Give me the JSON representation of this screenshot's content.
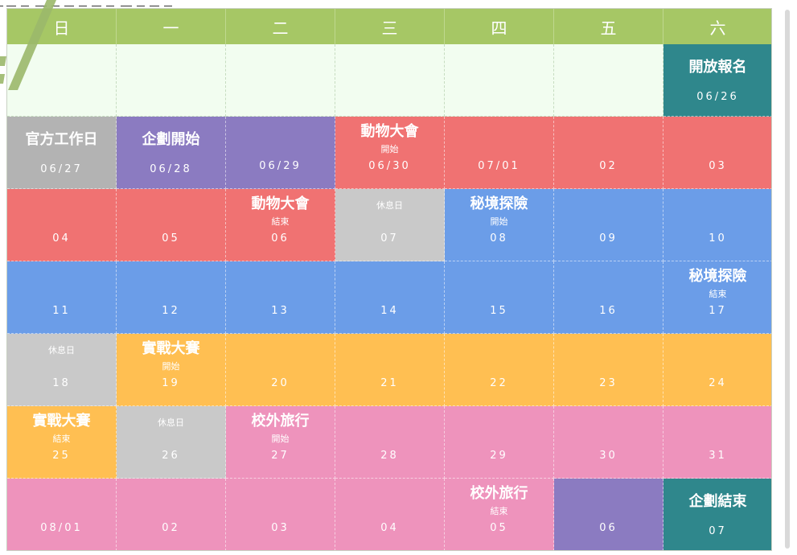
{
  "colors": {
    "header": "#a6c765",
    "empty": "#f2fdf0",
    "gray": "#c9c9c9",
    "gray_dark": "#b3b3b3",
    "purple": "#8b7bc1",
    "red": "#f07272",
    "blue": "#6b9de8",
    "orange": "#ffbf52",
    "pink": "#ee93bc",
    "teal": "#2f878c"
  },
  "calendar": {
    "weekdays": [
      "日",
      "一",
      "二",
      "三",
      "四",
      "五",
      "六"
    ],
    "weeks": [
      [
        {
          "color": "empty"
        },
        {
          "color": "empty"
        },
        {
          "color": "empty"
        },
        {
          "color": "empty"
        },
        {
          "color": "empty"
        },
        {
          "color": "empty"
        },
        {
          "color": "teal",
          "event": "開放報名",
          "date": "06/26"
        }
      ],
      [
        {
          "color": "gray_dark",
          "event": "官方工作日",
          "date": "06/27"
        },
        {
          "color": "purple",
          "event": "企劃開始",
          "date": "06/28"
        },
        {
          "color": "purple",
          "date": "06/29"
        },
        {
          "color": "red",
          "event": "動物大會",
          "sub": "開始",
          "date": "06/30"
        },
        {
          "color": "red",
          "date": "07/01"
        },
        {
          "color": "red",
          "date": "02"
        },
        {
          "color": "red",
          "date": "03"
        }
      ],
      [
        {
          "color": "red",
          "date": "04"
        },
        {
          "color": "red",
          "date": "05"
        },
        {
          "color": "red",
          "event": "動物大會",
          "sub": "結束",
          "date": "06"
        },
        {
          "color": "gray",
          "sub": "休息日",
          "date": "07"
        },
        {
          "color": "blue",
          "event": "秘境探險",
          "sub": "開始",
          "date": "08"
        },
        {
          "color": "blue",
          "date": "09"
        },
        {
          "color": "blue",
          "date": "10"
        }
      ],
      [
        {
          "color": "blue",
          "date": "11"
        },
        {
          "color": "blue",
          "date": "12"
        },
        {
          "color": "blue",
          "date": "13"
        },
        {
          "color": "blue",
          "date": "14"
        },
        {
          "color": "blue",
          "date": "15"
        },
        {
          "color": "blue",
          "date": "16"
        },
        {
          "color": "blue",
          "event": "秘境探險",
          "sub": "結束",
          "date": "17"
        }
      ],
      [
        {
          "color": "gray",
          "sub": "休息日",
          "date": "18"
        },
        {
          "color": "orange",
          "event": "實戰大賽",
          "sub": "開始",
          "date": "19"
        },
        {
          "color": "orange",
          "date": "20"
        },
        {
          "color": "orange",
          "date": "21"
        },
        {
          "color": "orange",
          "date": "22"
        },
        {
          "color": "orange",
          "date": "23"
        },
        {
          "color": "orange",
          "date": "24"
        }
      ],
      [
        {
          "color": "orange",
          "event": "實戰大賽",
          "sub": "結束",
          "date": "25"
        },
        {
          "color": "gray",
          "sub": "休息日",
          "date": "26"
        },
        {
          "color": "pink",
          "event": "校外旅行",
          "sub": "開始",
          "date": "27"
        },
        {
          "color": "pink",
          "date": "28"
        },
        {
          "color": "pink",
          "date": "29"
        },
        {
          "color": "pink",
          "date": "30"
        },
        {
          "color": "pink",
          "date": "31"
        }
      ],
      [
        {
          "color": "pink",
          "date": "08/01"
        },
        {
          "color": "pink",
          "date": "02"
        },
        {
          "color": "pink",
          "date": "03"
        },
        {
          "color": "pink",
          "date": "04"
        },
        {
          "color": "pink",
          "event": "校外旅行",
          "sub": "結束",
          "date": "05"
        },
        {
          "color": "purple",
          "date": "06"
        },
        {
          "color": "teal",
          "event": "企劃結束",
          "date": "07"
        }
      ]
    ]
  }
}
